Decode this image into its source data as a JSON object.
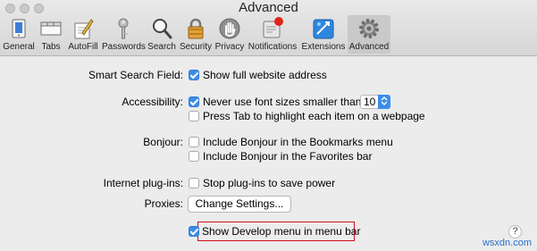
{
  "window": {
    "title": "Advanced"
  },
  "toolbar": {
    "items": [
      {
        "label": "General",
        "icon": "general-icon",
        "selected": false
      },
      {
        "label": "Tabs",
        "icon": "tabs-icon",
        "selected": false
      },
      {
        "label": "AutoFill",
        "icon": "autofill-icon",
        "selected": false
      },
      {
        "label": "Passwords",
        "icon": "key-icon",
        "selected": false
      },
      {
        "label": "Search",
        "icon": "search-icon",
        "selected": false
      },
      {
        "label": "Security",
        "icon": "lock-icon",
        "selected": false
      },
      {
        "label": "Privacy",
        "icon": "privacy-hand-icon",
        "selected": false
      },
      {
        "label": "Notifications",
        "icon": "notifications-icon",
        "selected": false
      },
      {
        "label": "Extensions",
        "icon": "extensions-icon",
        "selected": false
      },
      {
        "label": "Advanced",
        "icon": "gear-icon",
        "selected": true
      }
    ]
  },
  "settings": {
    "smart_search": {
      "label": "Smart Search Field:",
      "option": "Show full website address",
      "checked": true
    },
    "accessibility": {
      "label": "Accessibility:",
      "font_size_option": "Never use font sizes smaller than",
      "font_size_checked": true,
      "font_size_value": "10",
      "tab_option": "Press Tab to highlight each item on a webpage",
      "tab_checked": false
    },
    "bonjour": {
      "label": "Bonjour:",
      "bookmarks_option": "Include Bonjour in the Bookmarks menu",
      "bookmarks_checked": false,
      "favorites_option": "Include Bonjour in the Favorites bar",
      "favorites_checked": false
    },
    "plugins": {
      "label": "Internet plug-ins:",
      "option": "Stop plug-ins to save power",
      "checked": false
    },
    "proxies": {
      "label": "Proxies:",
      "button": "Change Settings..."
    },
    "develop": {
      "option": "Show Develop menu in menu bar",
      "checked": true
    }
  },
  "help": {
    "label": "?"
  },
  "watermark": "wsxdn.com",
  "colors": {
    "accent": "#3b8de7",
    "highlight_border": "#d0101a"
  }
}
